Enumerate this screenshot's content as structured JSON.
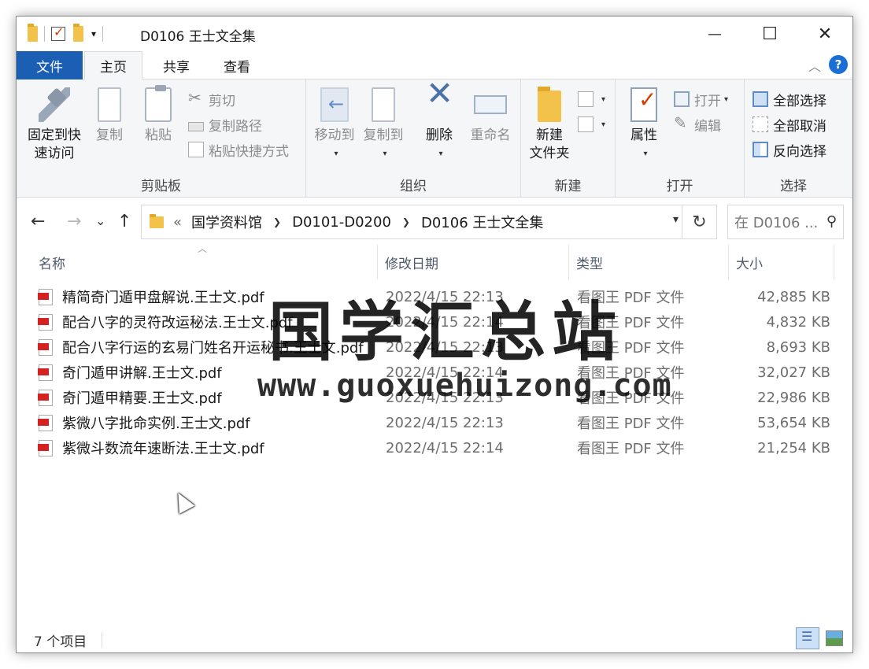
{
  "window": {
    "title": "D0106 王士文全集"
  },
  "titlebar": {
    "minimize": "—",
    "maximize": "☐",
    "close": "✕"
  },
  "tabs": {
    "file": "文件",
    "home": "主页",
    "share": "共享",
    "view": "查看"
  },
  "ribbon": {
    "clipboard": {
      "label": "剪贴板",
      "pin": "固定到快速访问",
      "pin_line1": "固定到快",
      "pin_line2": "速访问",
      "copy": "复制",
      "paste": "粘贴",
      "cut": "剪切",
      "copy_path": "复制路径",
      "paste_shortcut": "粘贴快捷方式"
    },
    "organize": {
      "label": "组织",
      "move_to": "移动到",
      "copy_to": "复制到",
      "delete": "删除",
      "rename": "重命名"
    },
    "new": {
      "label": "新建",
      "new_folder_line1": "新建",
      "new_folder_line2": "文件夹"
    },
    "open": {
      "label": "打开",
      "properties": "属性",
      "open": "打开",
      "edit": "编辑"
    },
    "select": {
      "label": "选择",
      "select_all": "全部选择",
      "select_none": "全部取消",
      "invert": "反向选择"
    }
  },
  "address": {
    "overflow": "«",
    "crumbs": [
      "国学资料馆",
      "D0101-D0200",
      "D0106 王士文全集"
    ]
  },
  "search": {
    "placeholder": "在 D0106 ..."
  },
  "columns": {
    "name": "名称",
    "date": "修改日期",
    "type": "类型",
    "size": "大小"
  },
  "files": [
    {
      "name": "精简奇门遁甲盘解说.王士文.pdf",
      "date": "2022/4/15 22:13",
      "type": "看图王 PDF 文件",
      "size": "42,885 KB"
    },
    {
      "name": "配合八字的灵符改运秘法.王士文.pdf",
      "date": "2022/4/15 22:14",
      "type": "看图王 PDF 文件",
      "size": "4,832 KB"
    },
    {
      "name": "配合八字行运的玄易门姓名开运秘书.王士文.pdf",
      "date": "2022/4/15 22:13",
      "type": "看图王 PDF 文件",
      "size": "8,693 KB"
    },
    {
      "name": "奇门遁甲讲解.王士文.pdf",
      "date": "2022/4/15 22:14",
      "type": "看图王 PDF 文件",
      "size": "32,027 KB"
    },
    {
      "name": "奇门遁甲精要.王士文.pdf",
      "date": "2022/4/15 22:13",
      "type": "看图王 PDF 文件",
      "size": "22,986 KB"
    },
    {
      "name": "紫微八字批命实例.王士文.pdf",
      "date": "2022/4/15 22:13",
      "type": "看图王 PDF 文件",
      "size": "53,654 KB"
    },
    {
      "name": "紫微斗数流年速断法.王士文.pdf",
      "date": "2022/4/15 22:14",
      "type": "看图王 PDF 文件",
      "size": "21,254 KB"
    }
  ],
  "watermark": {
    "title": "国学汇总站",
    "url": "www.guoxuehuizong.com"
  },
  "status": {
    "count": "7 个项目"
  },
  "icons": {
    "back": "←",
    "forward": "→",
    "recent": "⌄",
    "up": "↑",
    "refresh": "↻",
    "search": "⚲",
    "help": "?",
    "collapse": "︿"
  },
  "colors": {
    "file_tab": "#1a5fb4",
    "help": "#1a6fd6",
    "pdf_red": "#d32222"
  }
}
